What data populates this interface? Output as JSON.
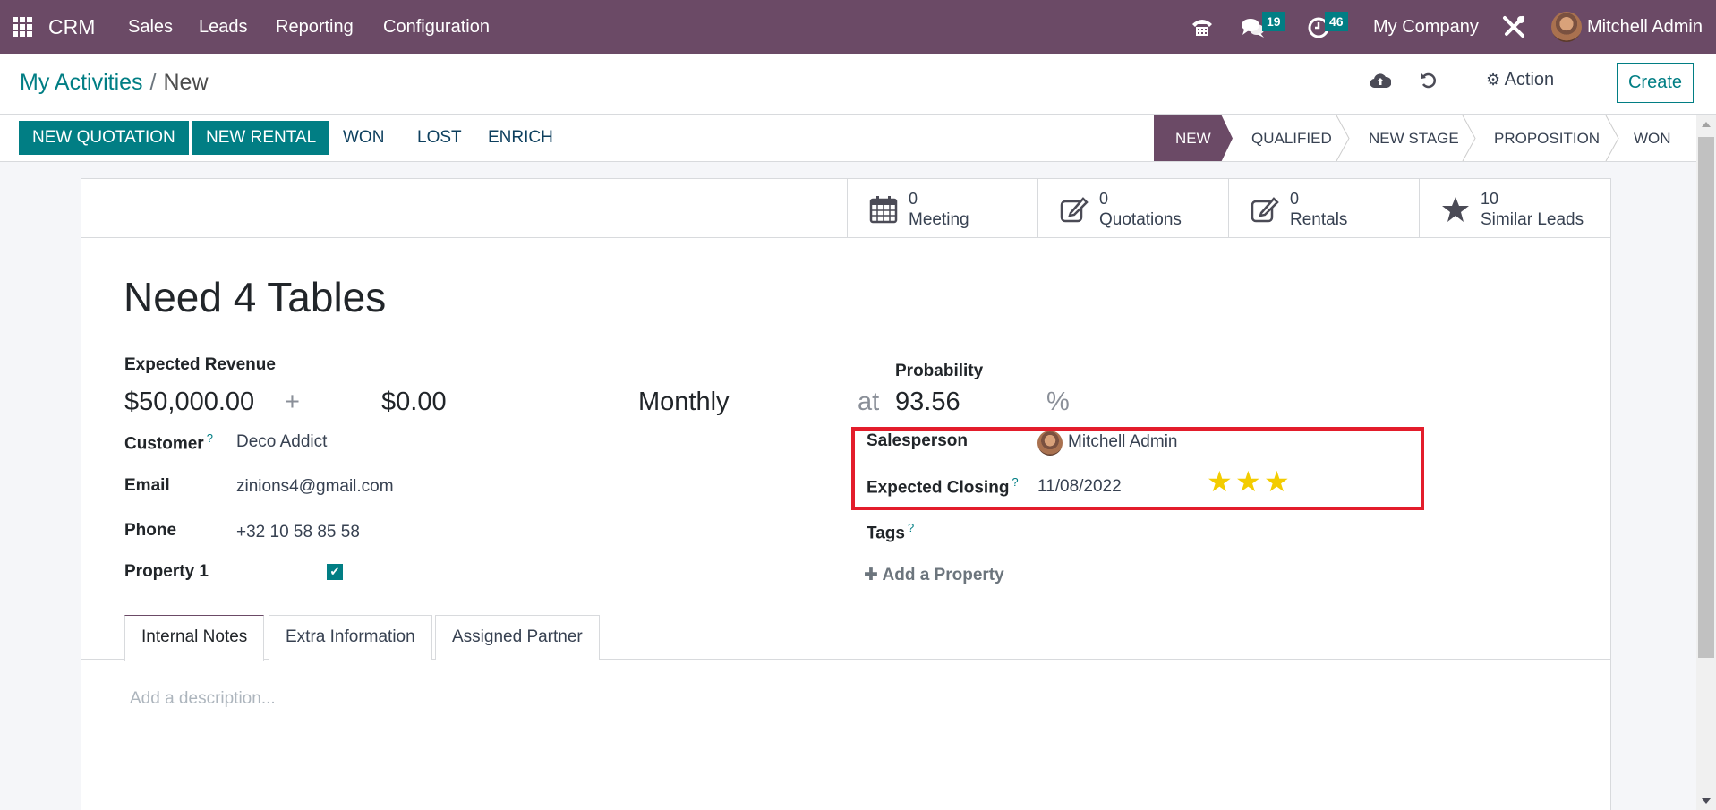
{
  "navbar": {
    "app_name": "CRM",
    "menu": [
      "Sales",
      "Leads",
      "Reporting",
      "Configuration"
    ],
    "icons": {
      "apps": "apps-grid-icon",
      "phone": "phone-icon",
      "messages": "chat-icon",
      "activities": "clock-icon",
      "settings": "tools-icon"
    },
    "messages_count": "19",
    "activities_count": "46",
    "company": "My Company",
    "user": "Mitchell Admin"
  },
  "control_panel": {
    "breadcrumb_parent": "My Activities",
    "breadcrumb_separator": "/",
    "breadcrumb_current": "New",
    "save_icon": "cloud-upload-icon",
    "discard_icon": "undo-icon",
    "action_label": "Action",
    "create_label": "Create"
  },
  "statusbar": {
    "buttons": [
      "NEW QUOTATION",
      "NEW RENTAL",
      "WON",
      "LOST",
      "ENRICH"
    ],
    "stages": [
      "NEW",
      "QUALIFIED",
      "NEW STAGE",
      "PROPOSITION",
      "WON"
    ],
    "active_stage": "NEW"
  },
  "smart_buttons": [
    {
      "value": "0",
      "label": "Meeting",
      "icon": "calendar-icon"
    },
    {
      "value": "0",
      "label": "Quotations",
      "icon": "edit-icon"
    },
    {
      "value": "0",
      "label": "Rentals",
      "icon": "edit-icon"
    },
    {
      "value": "10",
      "label": "Similar Leads",
      "icon": "star-icon"
    }
  ],
  "form": {
    "title": "Need 4 Tables",
    "expected_revenue_label": "Expected Revenue",
    "expected_revenue": "$50,000.00",
    "plus": "+",
    "recurring_revenue": "$0.00",
    "recurring_plan": "Monthly",
    "at": "at",
    "probability_label": "Probability",
    "probability": "93.56",
    "percent": "%",
    "customer_label": "Customer",
    "customer": "Deco Addict",
    "email_label": "Email",
    "email": "zinions4@gmail.com",
    "phone_label": "Phone",
    "phone": "+32 10 58 85 58",
    "property1_label": "Property 1",
    "property1_checked": true,
    "salesperson_label": "Salesperson",
    "salesperson": "Mitchell Admin",
    "expected_closing_label": "Expected Closing",
    "expected_closing": "11/08/2022",
    "priority_stars": 3,
    "priority_max": 3,
    "tags_label": "Tags",
    "add_property": "Add a Property",
    "help_mark": "?"
  },
  "tabs": {
    "items": [
      "Internal Notes",
      "Extra Information",
      "Assigned Partner"
    ],
    "active": "Internal Notes",
    "description_placeholder": "Add a description..."
  },
  "colors": {
    "brand": "#6b4a66",
    "primary": "#017e84",
    "highlight": "#e31d2b",
    "star": "#f3cc00"
  }
}
